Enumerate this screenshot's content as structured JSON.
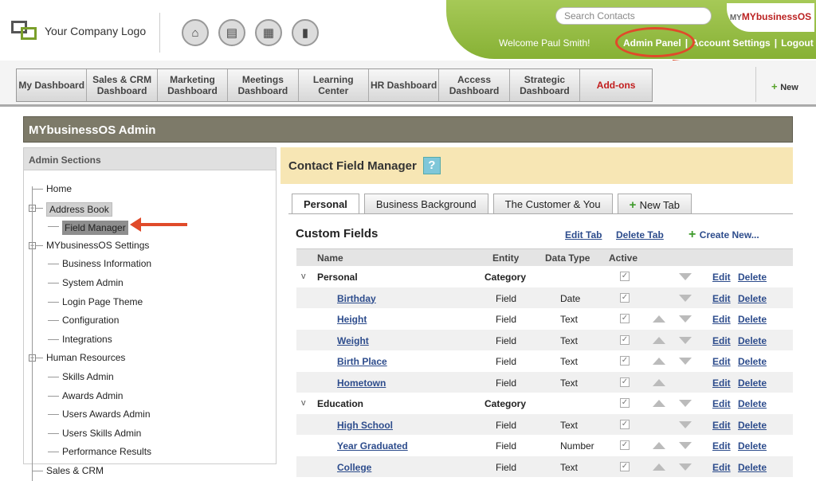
{
  "header": {
    "logo_text": "Your Company Logo",
    "search_placeholder": "Search Contacts",
    "brand": "MYbusinessOS",
    "welcome": "Welcome Paul Smith!",
    "links": [
      "Admin Panel",
      "|",
      "Account Settings",
      "|",
      "Logout"
    ],
    "icons": [
      "home-icon",
      "contact-card-icon",
      "calendar-icon",
      "book-icon"
    ]
  },
  "nav": {
    "items": [
      "My Dashboard",
      "Sales & CRM Dashboard",
      "Marketing Dashboard",
      "Meetings Dashboard",
      "Learning Center",
      "HR Dashboard",
      "Access Dashboard",
      "Strategic Dashboard",
      "Add-ons"
    ],
    "new_label": "New"
  },
  "admin_bar": {
    "title": "MYbusinessOS Admin"
  },
  "sidebar": {
    "title": "Admin Sections",
    "items": [
      {
        "label": "Home",
        "level": 0
      },
      {
        "label": "Address Book",
        "level": 0
      },
      {
        "label": "Field Manager",
        "level": 1
      },
      {
        "label": "MYbusinessOS Settings",
        "level": 0
      },
      {
        "label": "Business Information",
        "level": 1
      },
      {
        "label": "System Admin",
        "level": 1
      },
      {
        "label": "Login Page Theme",
        "level": 1
      },
      {
        "label": "Configuration",
        "level": 1
      },
      {
        "label": "Integrations",
        "level": 1
      },
      {
        "label": "Human Resources",
        "level": 0
      },
      {
        "label": "Skills Admin",
        "level": 1
      },
      {
        "label": "Awards Admin",
        "level": 1
      },
      {
        "label": "Users Awards Admin",
        "level": 1
      },
      {
        "label": "Users Skills Admin",
        "level": 1
      },
      {
        "label": "Performance Results",
        "level": 1
      },
      {
        "label": "Sales & CRM",
        "level": 0
      }
    ]
  },
  "main": {
    "title": "Contact Field Manager",
    "help": "?",
    "tabs": [
      "Personal",
      "Business Background",
      "The Customer & You",
      "New Tab"
    ],
    "section_title": "Custom Fields",
    "edit_tab": "Edit Tab",
    "delete_tab": "Delete Tab",
    "create_new": "Create New...",
    "columns": [
      "Name",
      "Entity",
      "Data Type",
      "Active"
    ],
    "action_edit": "Edit",
    "action_delete": "Delete",
    "rows": [
      {
        "name": "Personal",
        "entity": "Category",
        "type": "",
        "group": true,
        "up": false,
        "down": true
      },
      {
        "name": "Birthday",
        "entity": "Field",
        "type": "Date",
        "group": false,
        "up": false,
        "down": true
      },
      {
        "name": "Height",
        "entity": "Field",
        "type": "Text",
        "group": false,
        "up": true,
        "down": true
      },
      {
        "name": "Weight",
        "entity": "Field",
        "type": "Text",
        "group": false,
        "up": true,
        "down": true
      },
      {
        "name": "Birth Place",
        "entity": "Field",
        "type": "Text",
        "group": false,
        "up": true,
        "down": true
      },
      {
        "name": "Hometown",
        "entity": "Field",
        "type": "Text",
        "group": false,
        "up": true,
        "down": false
      },
      {
        "name": "Education",
        "entity": "Category",
        "type": "",
        "group": true,
        "up": true,
        "down": true
      },
      {
        "name": "High School",
        "entity": "Field",
        "type": "Text",
        "group": false,
        "up": false,
        "down": true
      },
      {
        "name": "Year Graduated",
        "entity": "Field",
        "type": "Number",
        "group": false,
        "up": true,
        "down": true
      },
      {
        "name": "College",
        "entity": "Field",
        "type": "Text",
        "group": false,
        "up": true,
        "down": true
      }
    ]
  }
}
